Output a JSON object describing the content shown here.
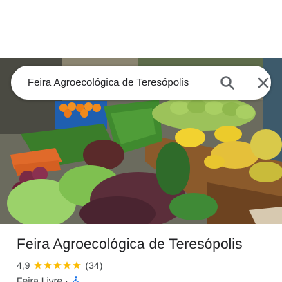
{
  "search": {
    "query": "Feira Agroecológica de Teresópolis",
    "search_icon": "search-icon",
    "close_icon": "close-icon"
  },
  "photo": {
    "description_icon": "place-photo"
  },
  "place": {
    "name": "Feira Agroecológica de Teresópolis",
    "rating": "4,9",
    "stars": 5,
    "review_count": "(34)",
    "category": "Feira Livre",
    "separator": "·",
    "accessibility_icon": "wheelchair-icon"
  },
  "colors": {
    "star": "#fbbc04",
    "accessibility": "#1a73e8",
    "text": "#202124",
    "secondary_text": "#3c4043"
  }
}
